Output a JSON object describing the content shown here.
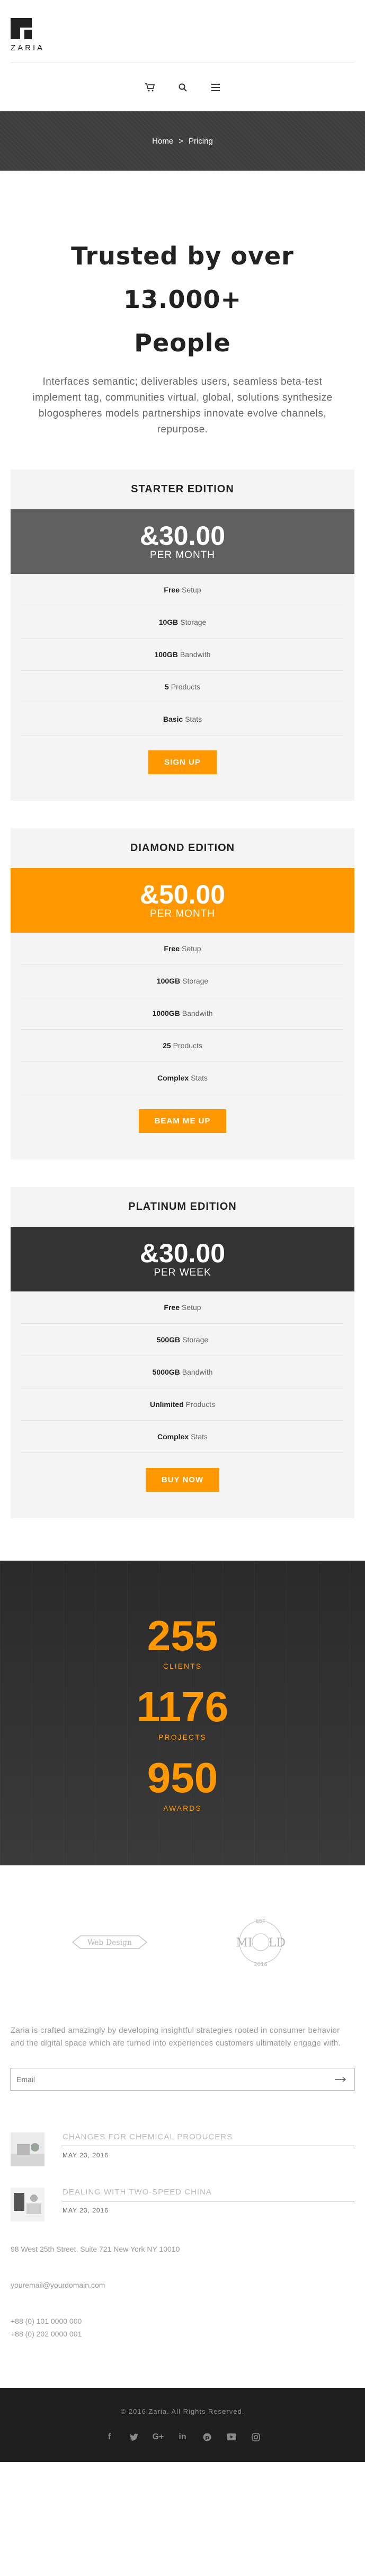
{
  "brand": {
    "name": "ZARIA"
  },
  "nav_icons": [
    "cart-icon",
    "search-icon",
    "menu-icon"
  ],
  "breadcrumb": {
    "home": "Home",
    "separator": ">",
    "current": "Pricing"
  },
  "intro": {
    "title_line1": "Trusted by over 13.000+",
    "title_line2": "People",
    "text": "Interfaces semantic; deliverables users, seamless beta-test implement tag, communities virtual, global, solutions synthesize blogospheres models partnerships innovate evolve channels, repurpose."
  },
  "plans": [
    {
      "title": "STARTER EDITION",
      "price": "&30.00",
      "period": "PER MONTH",
      "price_bg": "#606060",
      "features": [
        {
          "value": "Free",
          "label": "Setup"
        },
        {
          "value": "10GB",
          "label": "Storage"
        },
        {
          "value": "100GB",
          "label": "Bandwith"
        },
        {
          "value": "5",
          "label": "Products"
        },
        {
          "value": "Basic",
          "label": "Stats"
        }
      ],
      "button": "SIGN UP"
    },
    {
      "title": "DIAMOND EDITION",
      "price": "&50.00",
      "period": "PER MONTH",
      "price_bg": "#ff9800",
      "features": [
        {
          "value": "Free",
          "label": "Setup"
        },
        {
          "value": "100GB",
          "label": "Storage"
        },
        {
          "value": "1000GB",
          "label": "Bandwith"
        },
        {
          "value": "25",
          "label": "Products"
        },
        {
          "value": "Complex",
          "label": "Stats"
        }
      ],
      "button": "BEAM ME UP"
    },
    {
      "title": "PLATINUM EDITION",
      "price": "&30.00",
      "period": "PER WEEK",
      "price_bg": "#333333",
      "features": [
        {
          "value": "Free",
          "label": "Setup"
        },
        {
          "value": "500GB",
          "label": "Storage"
        },
        {
          "value": "5000GB",
          "label": "Bandwith"
        },
        {
          "value": "Unlimited",
          "label": "Products"
        },
        {
          "value": "Complex",
          "label": "Stats"
        }
      ],
      "button": "BUY NOW"
    }
  ],
  "stats": [
    {
      "number": "255",
      "label": "CLIENTS"
    },
    {
      "number": "1176",
      "label": "PROJECTS"
    },
    {
      "number": "950",
      "label": "AWARDS"
    }
  ],
  "partner_logos": {
    "left": {
      "name": "webdesign-logo",
      "text": "Web Design"
    },
    "right": {
      "name": "mild-logo",
      "top": "EST",
      "left": "MI",
      "right": "LD",
      "bottom": "2016"
    }
  },
  "footer": {
    "about": "Zaria is crafted amazingly by developing insightful strategies rooted in consumer behavior and the digital space which are turned into experiences customers ultimately engage with.",
    "email_placeholder": "Email",
    "posts": [
      {
        "title": "CHANGES FOR CHEMICAL PRODUCERS",
        "date": "MAY 23, 2016"
      },
      {
        "title": "DEALING WITH TWO-SPEED CHINA",
        "date": "MAY 23, 2016"
      }
    ],
    "address": "98 West 25th Street, Suite 721 New York NY 10010",
    "email": "youremail@yourdomain.com",
    "phone1": "+88 (0) 101 0000 000",
    "phone2": "+88 (0) 202 0000 001",
    "copyright": "© 2016 Zaria. All Rights Reserved.",
    "social": [
      "facebook-icon",
      "twitter-icon",
      "google-plus-icon",
      "linkedin-icon",
      "pinterest-icon",
      "youtube-icon",
      "instagram-icon"
    ]
  },
  "colors": {
    "accent": "#ff9800",
    "dark": "#2f2f2f"
  }
}
